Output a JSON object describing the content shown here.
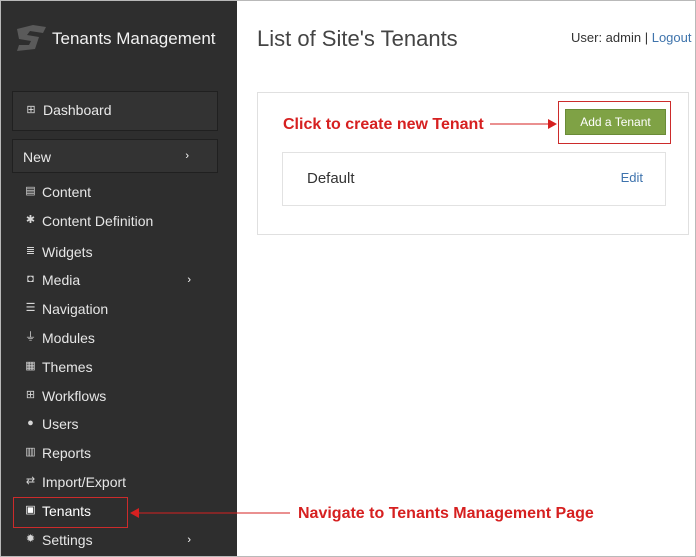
{
  "app": {
    "brand": "Tenants Management"
  },
  "sidebar": {
    "dashboard": {
      "label": "Dashboard",
      "icon": "dashboard-icon"
    },
    "new": {
      "label": "New"
    },
    "items": [
      {
        "label": "Content",
        "icon": "document-icon",
        "has_children": false
      },
      {
        "label": "Content Definition",
        "icon": "puzzle-icon",
        "has_children": false
      },
      {
        "label": "Widgets",
        "icon": "list-icon",
        "has_children": false
      },
      {
        "label": "Media",
        "icon": "camera-icon",
        "has_children": true
      },
      {
        "label": "Navigation",
        "icon": "navigation-icon",
        "has_children": false
      },
      {
        "label": "Modules",
        "icon": "plug-icon",
        "has_children": false
      },
      {
        "label": "Themes",
        "icon": "theme-icon",
        "has_children": false
      },
      {
        "label": "Workflows",
        "icon": "sitemap-icon",
        "has_children": false
      },
      {
        "label": "Users",
        "icon": "user-icon",
        "has_children": false
      },
      {
        "label": "Reports",
        "icon": "bar-chart-icon",
        "has_children": false
      },
      {
        "label": "Import/Export",
        "icon": "exchange-icon",
        "has_children": false
      },
      {
        "label": "Tenants",
        "icon": "tenants-icon",
        "has_children": false,
        "active": true
      },
      {
        "label": "Settings",
        "icon": "gear-icon",
        "has_children": true
      }
    ]
  },
  "header": {
    "title": "List of Site's Tenants",
    "user_text": "User: admin",
    "separator": "|",
    "logout": "Logout"
  },
  "tenants": {
    "add_button": "Add a Tenant",
    "rows": [
      {
        "name": "Default",
        "edit": "Edit"
      }
    ]
  },
  "annotations": {
    "create": "Click to create new Tenant",
    "navigate": "Navigate to Tenants Management Page",
    "color": "#d62020"
  },
  "colors": {
    "sidebar_bg": "#2e2e2e",
    "accent_green": "#7fa245",
    "link_blue": "#3e73ad",
    "annotation_red": "#d62020"
  }
}
